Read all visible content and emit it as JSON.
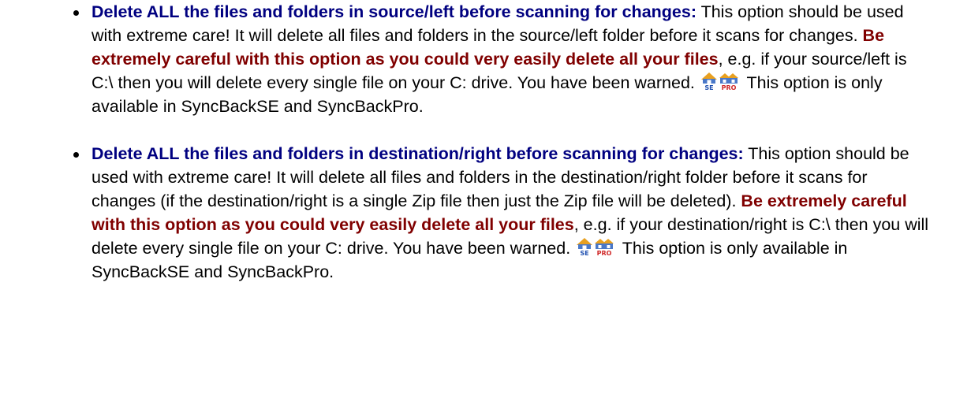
{
  "options": [
    {
      "title": "Delete ALL the files and folders in source/left before scanning for changes:",
      "intro": " This option should be used with extreme care! It will delete all files and folders in the source/left folder before it scans for changes. ",
      "warning": "Be extremely careful with this option as you could very easily delete all your files",
      "after": ", e.g. if your source/left is C:\\ then you will delete every single file on your C: drive. You have been warned.",
      "availability": " This option is only available in SyncBackSE and SyncBackPro."
    },
    {
      "title": "Delete ALL the files and folders in destination/right before scanning for changes:",
      "intro": " This option should be used with extreme care! It will delete all files and folders in the destination/right folder before it scans for changes (if the destination/right is a single Zip file then just the Zip file will be deleted). ",
      "warning": "Be extremely careful with this option as you could very easily delete all your files",
      "after": ", e.g. if your destination/right is C:\\ then you will delete every single file on your C: drive. You have been warned.",
      "availability": " This option is only available in SyncBackSE and SyncBackPro."
    }
  ],
  "icons": {
    "se": {
      "name": "syncbackse-icon",
      "label": "SE",
      "roof": "#e8a020",
      "body": "#4a78c8",
      "label_color": "#2050b0"
    },
    "pro": {
      "name": "syncbackpro-icon",
      "label": "PRO",
      "roof": "#e8a020",
      "body": "#4a78c8",
      "label_color": "#d02828"
    }
  }
}
